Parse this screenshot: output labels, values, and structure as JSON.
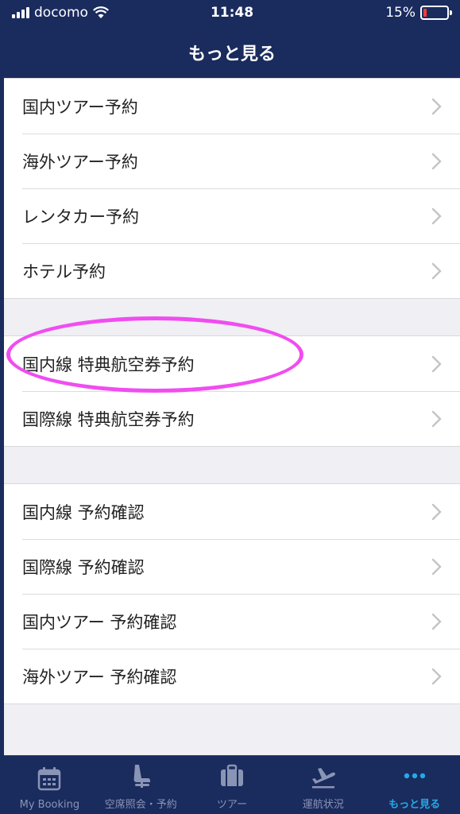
{
  "status_bar": {
    "carrier": "docomo",
    "time": "11:48",
    "battery": "15%",
    "battery_level": 0.15
  },
  "nav": {
    "title": "もっと見る"
  },
  "groups": [
    {
      "items": [
        "国内ツアー予約",
        "海外ツアー予約",
        "レンタカー予約",
        "ホテル予約"
      ]
    },
    {
      "items": [
        "国内線 特典航空券予約",
        "国際線 特典航空券予約"
      ]
    },
    {
      "items": [
        "国内線 予約確認",
        "国際線 予約確認",
        "国内ツアー 予約確認",
        "海外ツアー 予約確認"
      ]
    }
  ],
  "tabs": [
    {
      "label": "My Booking",
      "icon": "calendar-icon"
    },
    {
      "label": "空席照会・予約",
      "icon": "seat-icon"
    },
    {
      "label": "ツアー",
      "icon": "suitcase-icon"
    },
    {
      "label": "運航状況",
      "icon": "airplane-departure-icon"
    },
    {
      "label": "もっと見る",
      "icon": "more-dots-icon",
      "active": true
    }
  ],
  "colors": {
    "header": "#1a2b5e",
    "active_tab": "#27a8e6",
    "highlight": "#f04df0",
    "battery_low": "#ff3b30"
  }
}
